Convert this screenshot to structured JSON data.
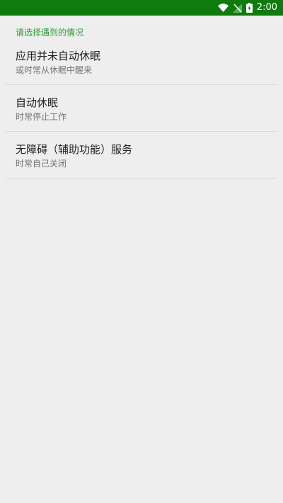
{
  "status_bar": {
    "time": "2:00",
    "icons": [
      "wifi-icon",
      "no-signal-icon",
      "battery-charging-icon"
    ],
    "background_color": "#0f7b0f"
  },
  "settings": {
    "section_header": "请选择遇到的情况",
    "items": [
      {
        "title": "应用并未自动休眠",
        "subtitle": "或时常从休眠中醒来"
      },
      {
        "title": "自动休眠",
        "subtitle": "时常停止工作"
      },
      {
        "title": "无障碍（辅助功能）服务",
        "subtitle": "时常自己关闭"
      }
    ],
    "accent_color": "#2e9b38"
  }
}
